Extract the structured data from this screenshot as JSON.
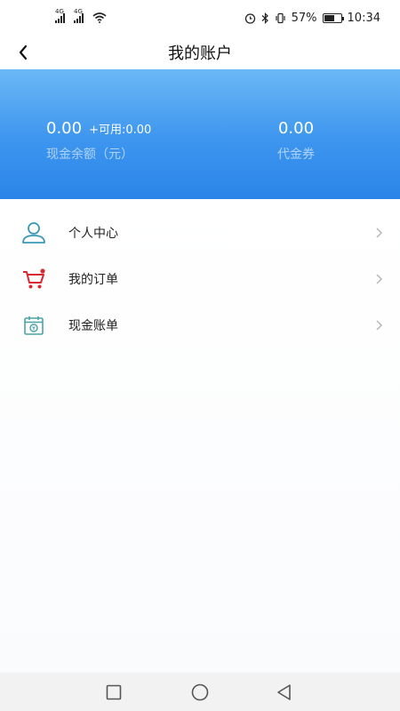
{
  "status_bar": {
    "network1": "4G",
    "network2": "4G",
    "battery_percent": "57%",
    "battery_level": 0.57,
    "time": "10:34"
  },
  "nav": {
    "title": "我的账户",
    "back_icon": "chevron-left-icon"
  },
  "account": {
    "cash_amount": "0.00",
    "available": "+可用:0.00",
    "cash_label": "现金余额（元）",
    "voucher_amount": "0.00",
    "voucher_label": "代金券"
  },
  "menu": [
    {
      "label": "个人中心",
      "icon": "person-icon",
      "icon_color": "#3b97b5"
    },
    {
      "label": "我的订单",
      "icon": "shopping-cart-icon",
      "icon_color": "#d9282f"
    },
    {
      "label": "现金账单",
      "icon": "calendar-bill-icon",
      "icon_color": "#4aa3a6"
    }
  ],
  "colors": {
    "header_top": "#6bb8f6",
    "header_bottom": "#2a85e8"
  }
}
